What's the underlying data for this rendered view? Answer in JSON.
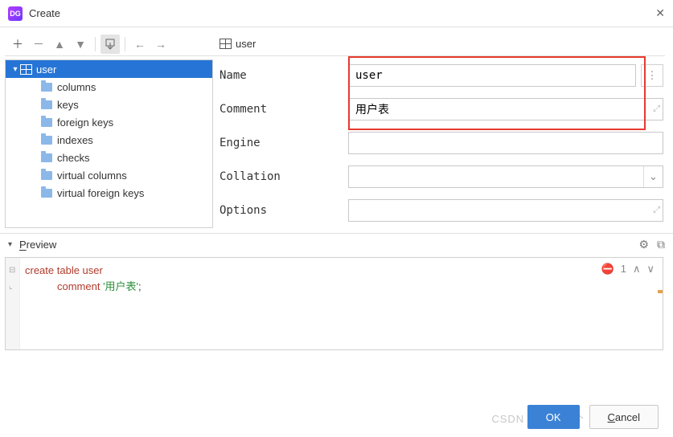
{
  "window": {
    "title": "Create",
    "app_icon_text": "DG"
  },
  "tree": {
    "root": {
      "label": "user"
    },
    "children": [
      {
        "label": "columns"
      },
      {
        "label": "keys"
      },
      {
        "label": "foreign keys"
      },
      {
        "label": "indexes"
      },
      {
        "label": "checks"
      },
      {
        "label": "virtual columns"
      },
      {
        "label": "virtual foreign keys"
      }
    ]
  },
  "crumb": {
    "label": "user"
  },
  "form": {
    "name": {
      "label": "Name",
      "value": "user"
    },
    "comment": {
      "label": "Comment",
      "value": "用户表"
    },
    "engine": {
      "label": "Engine",
      "value": ""
    },
    "collation": {
      "label": "Collation",
      "value": ""
    },
    "options": {
      "label": "Options",
      "value": ""
    }
  },
  "preview": {
    "title_prefix": "P",
    "title_rest": "review",
    "error_count": "1",
    "sql": {
      "line1_kw": "create table ",
      "line1_id": "user",
      "line2_kw": "comment ",
      "line2_str": "'用户表'",
      "line2_end": ";"
    }
  },
  "buttons": {
    "ok": "OK",
    "cancel_prefix": "C",
    "cancel_rest": "ancel"
  },
  "watermark": "CSDN @不写八个"
}
